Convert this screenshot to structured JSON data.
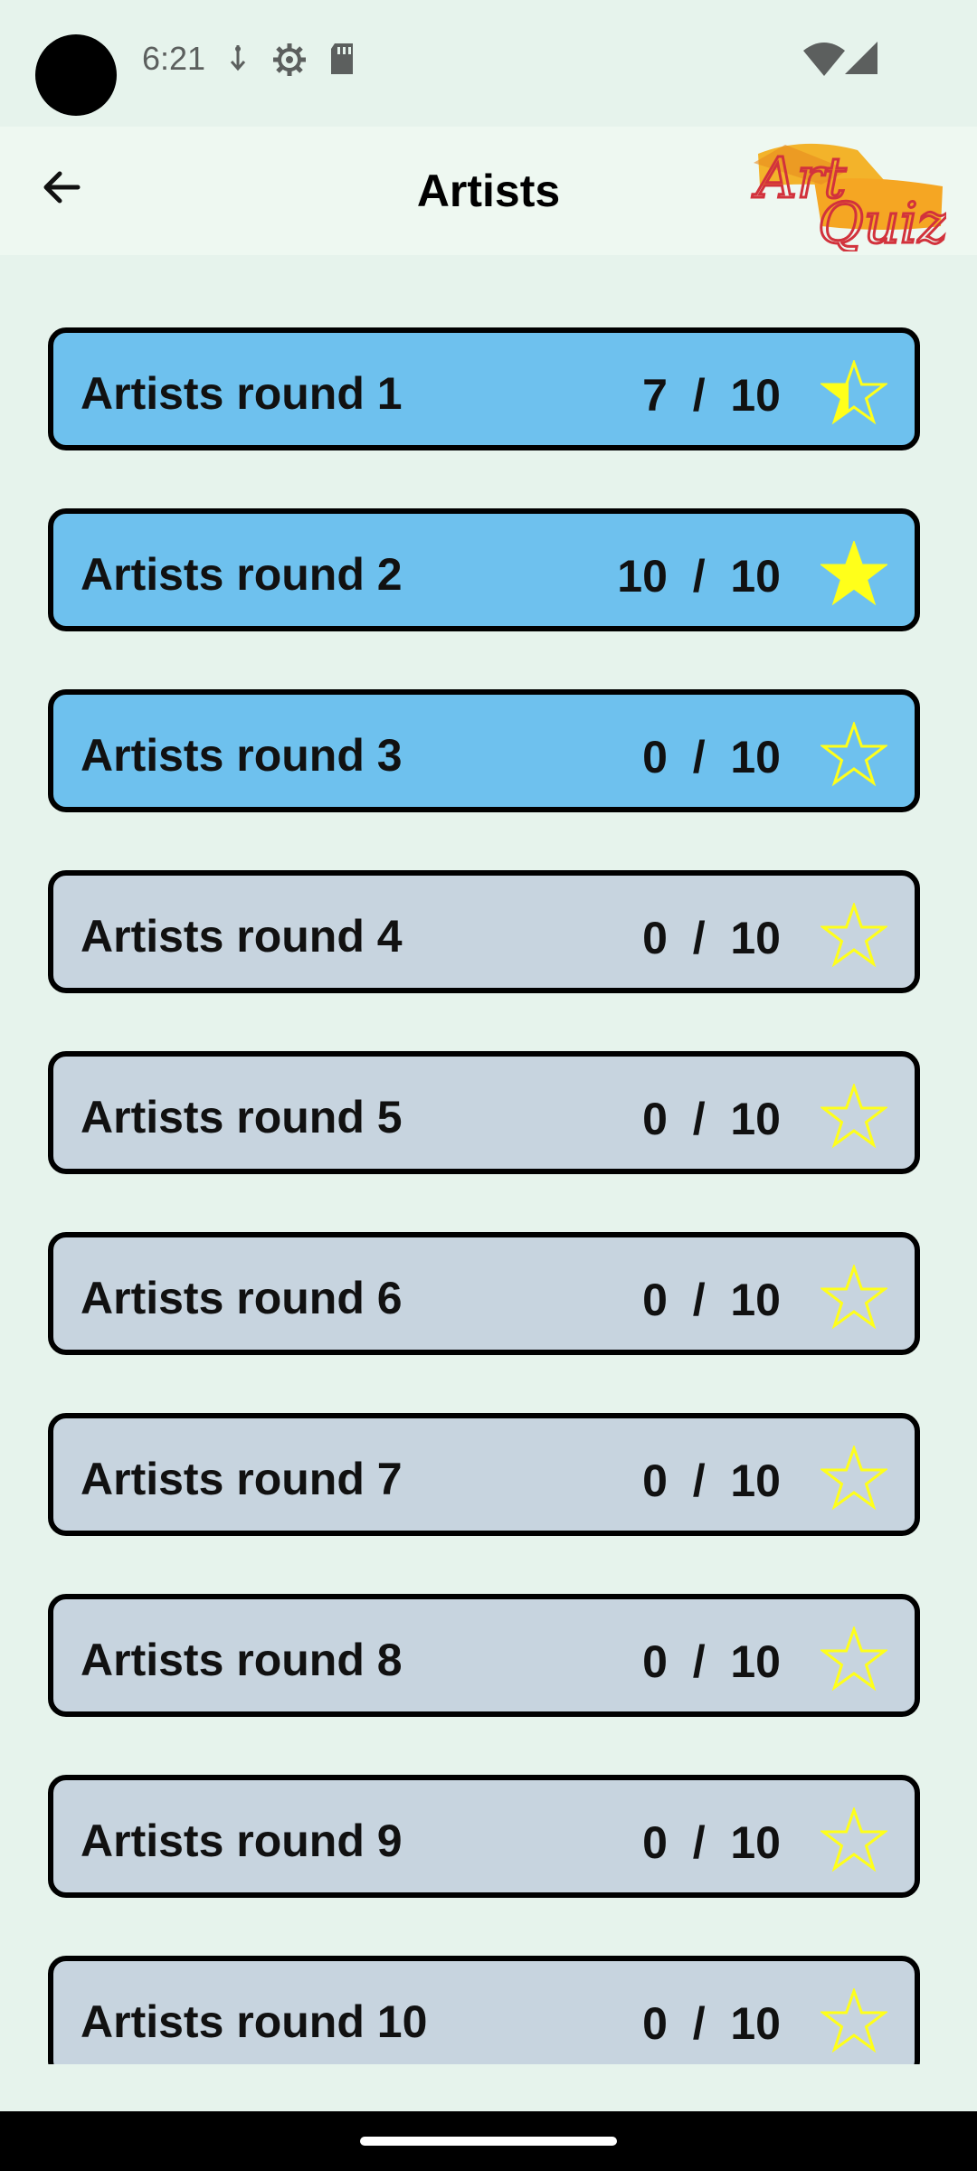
{
  "status": {
    "time": "6:21"
  },
  "app_bar": {
    "title": "Artists",
    "logo_text_1": "Art",
    "logo_text_2": "Quiz"
  },
  "rounds": [
    {
      "label": "Artists round 1",
      "score": "7  /  10",
      "correct": 7,
      "total": 10,
      "star": "half"
    },
    {
      "label": "Artists round 2",
      "score": "10  /  10",
      "correct": 10,
      "total": 10,
      "star": "full"
    },
    {
      "label": "Artists round 3",
      "score": "0  /  10",
      "correct": 0,
      "total": 10,
      "star": "empty"
    },
    {
      "label": "Artists round 4",
      "score": "0  /  10",
      "correct": 0,
      "total": 10,
      "star": "empty"
    },
    {
      "label": "Artists round 5",
      "score": "0  /  10",
      "correct": 0,
      "total": 10,
      "star": "empty"
    },
    {
      "label": "Artists round 6",
      "score": "0  /  10",
      "correct": 0,
      "total": 10,
      "star": "empty"
    },
    {
      "label": "Artists round 7",
      "score": "0  /  10",
      "correct": 0,
      "total": 10,
      "star": "empty"
    },
    {
      "label": "Artists round 8",
      "score": "0  /  10",
      "correct": 0,
      "total": 10,
      "star": "empty"
    },
    {
      "label": "Artists round 9",
      "score": "0  /  10",
      "correct": 0,
      "total": 10,
      "star": "empty"
    },
    {
      "label": "Artists round 10",
      "score": "0  /  10",
      "correct": 0,
      "total": 10,
      "star": "empty"
    }
  ],
  "colors": {
    "unlocked_round": "#6ec1ee",
    "locked_round": "#c7d4df",
    "star": "#ffff1a"
  }
}
